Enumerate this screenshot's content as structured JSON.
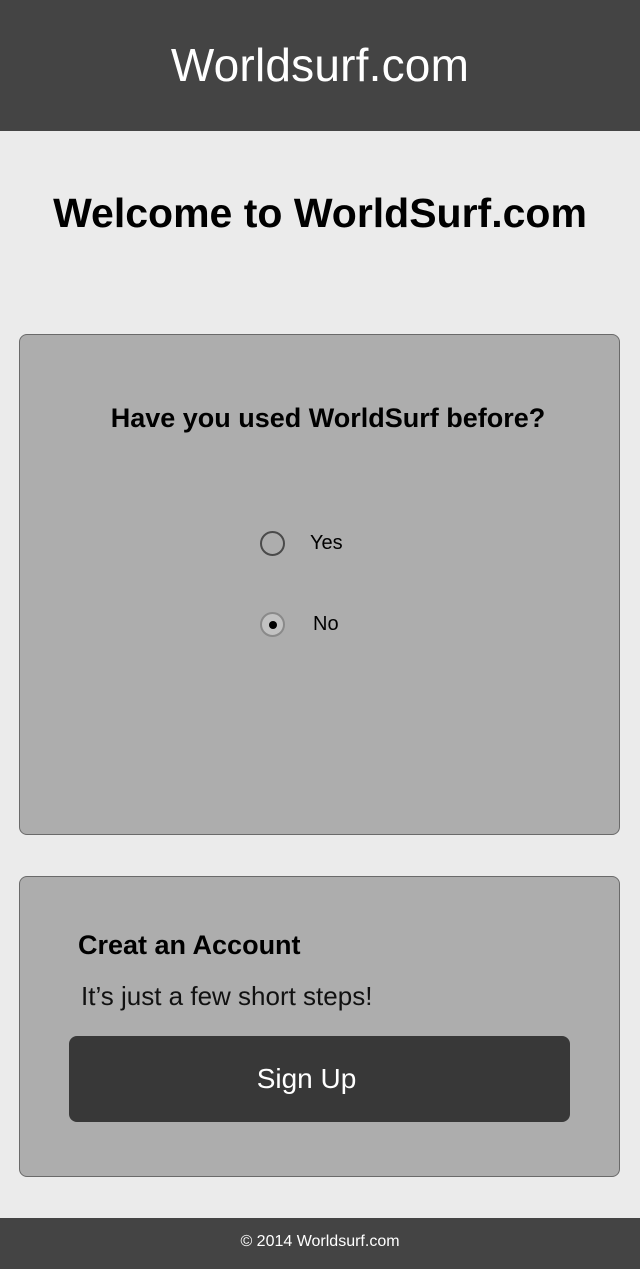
{
  "header": {
    "title": "Worldsurf.com"
  },
  "welcome": {
    "heading": "Welcome to WorldSurf.com"
  },
  "question_card": {
    "question": "Have you used WorldSurf before?",
    "options": [
      {
        "label": "Yes",
        "selected": false
      },
      {
        "label": "No",
        "selected": true
      }
    ]
  },
  "account_card": {
    "title": "Creat an Account",
    "subtitle": "It’s just a few short steps!",
    "button_label": "Sign Up"
  },
  "footer": {
    "text": "© 2014 Worldsurf.com"
  },
  "colors": {
    "header_bg": "#444444",
    "page_bg": "#ebebeb",
    "card_bg": "#adadad",
    "button_bg": "#383838"
  }
}
